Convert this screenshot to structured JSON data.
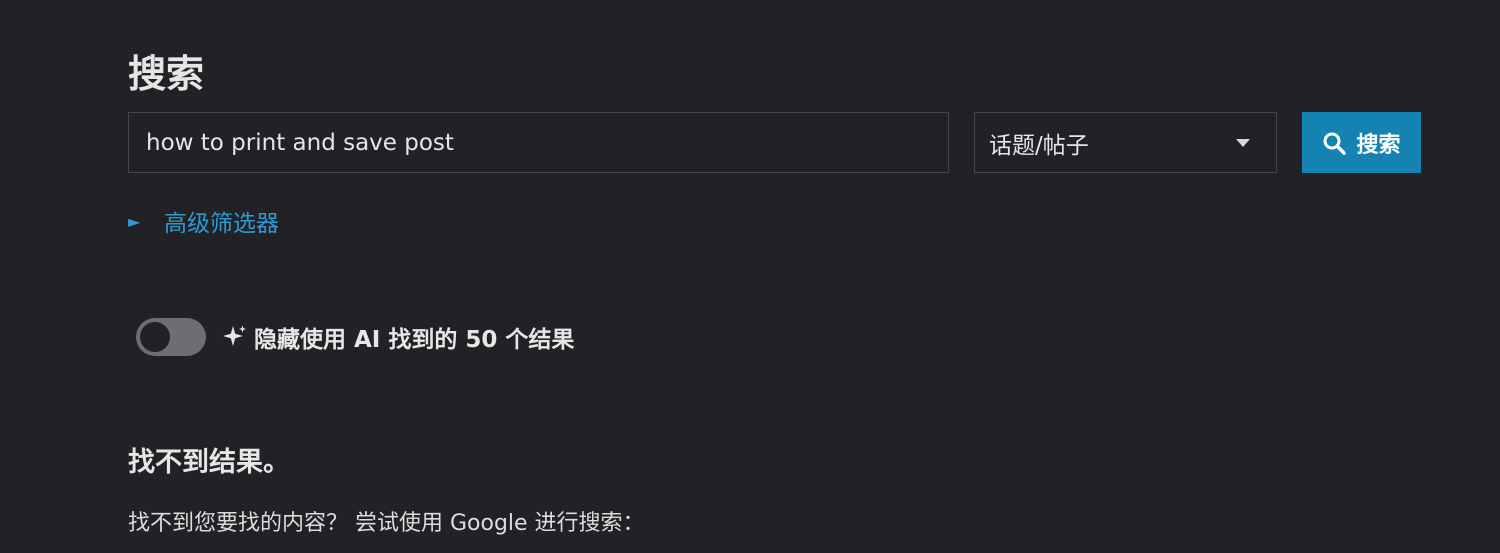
{
  "page": {
    "title": "搜索"
  },
  "search": {
    "query": "how to print and save post",
    "type_select": "话题/帖子",
    "button_label": "搜索"
  },
  "advanced": {
    "label": "高级筛选器",
    "arrow_glyph": "►"
  },
  "ai_toggle": {
    "label": "隐藏使用 AI 找到的 50 个结果",
    "enabled": false
  },
  "results": {
    "empty_title": "找不到结果。",
    "google_hint": "找不到您要找的内容？ 尝试使用 Google 进行搜索："
  },
  "icons": {
    "search": "search-icon",
    "sparkle": "sparkle-icon",
    "dropdown": "caret-down-icon",
    "disclosure": "disclosure-triangle-icon"
  },
  "colors": {
    "background": "#222226",
    "accent": "#1483b2",
    "link": "#2a9bd6",
    "border": "#45454c"
  }
}
